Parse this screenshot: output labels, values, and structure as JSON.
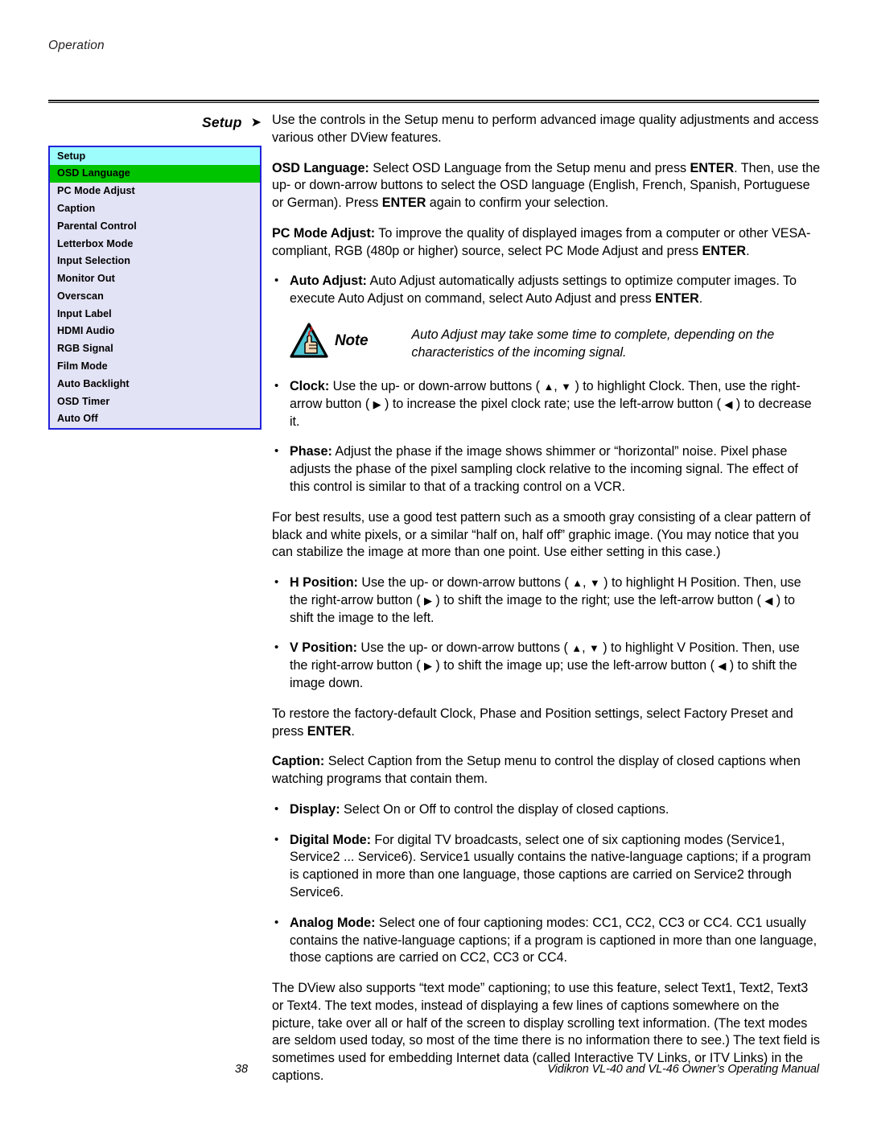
{
  "page": {
    "running_head": "Operation",
    "page_number": "38",
    "manual_title": "Vidikron VL-40 and VL-46 Owner’s Operating Manual"
  },
  "section": {
    "label": "Setup",
    "arrow_glyph": "➤"
  },
  "colors": {
    "menu_border": "#2222dd",
    "menu_title_bg": "#9dfdfd",
    "menu_active_bg": "#00c400",
    "menu_body_bg": "#e3e3f6",
    "note_icon_fill": "#4fc4d3",
    "note_icon_accent": "#cc2222",
    "text": "#000000"
  },
  "osd_menu": {
    "title": "Setup",
    "items": [
      {
        "label": "OSD Language",
        "state": "active"
      },
      {
        "label": "PC Mode Adjust",
        "state": "normal"
      },
      {
        "label": "Caption",
        "state": "normal"
      },
      {
        "label": "Parental Control",
        "state": "normal"
      },
      {
        "label": "Letterbox Mode",
        "state": "normal"
      },
      {
        "label": "Input Selection",
        "state": "normal"
      },
      {
        "label": "Monitor Out",
        "state": "normal"
      },
      {
        "label": "Overscan",
        "state": "normal"
      },
      {
        "label": "Input Label",
        "state": "normal"
      },
      {
        "label": "HDMI Audio",
        "state": "normal"
      },
      {
        "label": "RGB Signal",
        "state": "normal"
      },
      {
        "label": "Film Mode",
        "state": "normal"
      },
      {
        "label": "Auto Backlight",
        "state": "normal"
      },
      {
        "label": "OSD Timer",
        "state": "normal"
      },
      {
        "label": "Auto Off",
        "state": "normal"
      }
    ]
  },
  "body": {
    "intro": "Use the controls in the Setup menu to perform advanced image quality adjustments and access various other DView features.",
    "osd_language": {
      "term": "OSD Language:",
      "text_a": " Select OSD Language from the Setup menu and press ",
      "enter_1": "ENTER",
      "text_b": ". Then, use the up- or down-arrow buttons to select the OSD language (English, French, Spanish, Portuguese or German). Press ",
      "enter_2": "ENTER",
      "text_c": " again to confirm your selection."
    },
    "pc_mode_adjust": {
      "term": "PC Mode Adjust:",
      "text_a": " To improve the quality of displayed images from a computer or other VESA-compliant, RGB (480p or higher) source, select PC Mode Adjust and press ",
      "enter_1": "ENTER",
      "text_b": "."
    },
    "auto_adjust": {
      "term": "Auto Adjust:",
      "text_a": " Auto Adjust automatically adjusts settings to optimize computer images. To execute Auto Adjust on command, select Auto Adjust and press ",
      "enter_1": "ENTER",
      "text_b": "."
    },
    "note": {
      "label": "Note",
      "text": "Auto Adjust may take some time to complete, depending on the characteristics of the incoming signal."
    },
    "clock": {
      "term": "Clock:",
      "text_a": " Use the up- or down-arrow buttons ( ",
      "up_glyph": "▲",
      "comma": ", ",
      "down_glyph": "▼",
      "text_b": " ) to highlight Clock. Then, use the right-arrow button ( ",
      "right_glyph": "▶",
      "text_c": " ) to increase the pixel clock rate; use the left-arrow button ( ",
      "left_glyph": "◀",
      "text_d": " ) to decrease it."
    },
    "phase": {
      "term": "Phase:",
      "text_a": " Adjust the phase if the image shows shimmer or “horizontal” noise. Pixel phase adjusts the phase of the pixel sampling clock relative to the incoming signal. The effect of this control is similar to that of a tracking control on a VCR."
    },
    "best_results": "For best results, use a good test pattern such as a smooth gray consisting of a clear pattern of black and white pixels, or a similar “half on, half off” graphic image. (You may notice that you can stabilize the image at more than one point. Use either setting in this case.)",
    "h_position": {
      "term": "H Position:",
      "text_a": " Use the up- or down-arrow buttons ( ",
      "up_glyph": "▲",
      "comma": ", ",
      "down_glyph": "▼",
      "text_b": " ) to highlight H Position. Then, use the right-arrow button ( ",
      "right_glyph": "▶",
      "text_c": " ) to shift the image to the right; use the left-arrow button ( ",
      "left_glyph": "◀",
      "text_d": " ) to shift the image to the left."
    },
    "v_position": {
      "term": "V Position:",
      "text_a": " Use the up- or down-arrow buttons ( ",
      "up_glyph": "▲",
      "comma": ", ",
      "down_glyph": "▼",
      "text_b": " ) to highlight V Position. Then, use the right-arrow button ( ",
      "right_glyph": "▶",
      "text_c": " ) to shift the image up; use the left-arrow button ( ",
      "left_glyph": "◀",
      "text_d": " ) to shift the image down."
    },
    "factory_preset": {
      "text_a": "To restore the factory-default Clock, Phase and Position settings, select Factory Preset and press ",
      "enter_1": "ENTER",
      "text_b": "."
    },
    "caption": {
      "term": "Caption:",
      "text_a": " Select Caption from the Setup menu to control the display of closed captions when watching programs that contain them."
    },
    "display": {
      "term": "Display:",
      "text_a": " Select On or Off to control the display of closed captions."
    },
    "digital_mode": {
      "term": "Digital Mode:",
      "text_a": " For digital TV broadcasts, select one of six captioning modes (Service1, Service2 ... Service6). Service1 usually contains the native-language captions; if a program is captioned in more than one language, those captions are carried on Service2 through Service6."
    },
    "analog_mode": {
      "term": "Analog Mode:",
      "text_a": " Select one of four captioning modes: CC1, CC2, CC3 or CC4. CC1 usually contains the native-language captions; if a program is captioned in more than one language, those captions are carried on CC2, CC3 or CC4."
    },
    "text_mode": "The DView also supports “text mode” captioning; to use this feature, select Text1, Text2, Text3 or Text4. The text modes, instead of displaying a few lines of captions somewhere on the picture, take over all or half of the screen to display scrolling text information. (The text modes are seldom used today, so most of the time there is no information there to see.) The text field is sometimes used for embedding Internet data (called Interactive TV Links, or ITV Links) in the captions."
  }
}
